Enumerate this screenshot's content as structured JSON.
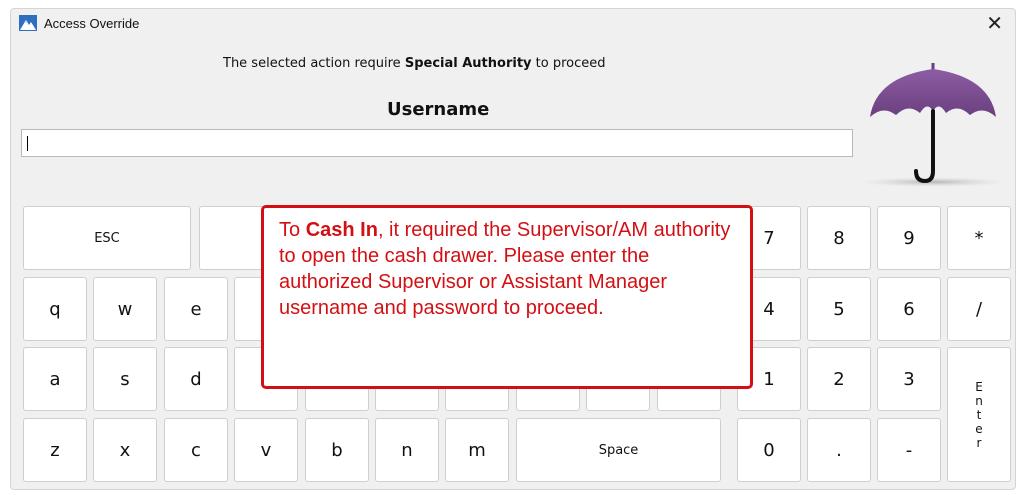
{
  "window": {
    "title": "Access Override",
    "close_glyph": "✕",
    "app_icon": "app-logo-icon"
  },
  "message": {
    "prefix": "The selected action require",
    "bold": "Special Authority",
    "suffix": "to proceed"
  },
  "username": {
    "label": "Username",
    "value": ""
  },
  "umbrella_icon": "umbrella-icon",
  "colors": {
    "window_bg": "#f0f0f0",
    "key_bg": "#ffffff",
    "callout_red": "#d40f14",
    "umbrella_purple": "#7a4d8d"
  },
  "keypad": {
    "esc": "ESC",
    "row_q": [
      "q",
      "w",
      "e"
    ],
    "row_a": [
      "a",
      "s",
      "d"
    ],
    "row_z": [
      "z",
      "x",
      "c",
      "v",
      "b",
      "n",
      "m"
    ],
    "space": "Space",
    "num_row1": [
      "7",
      "8",
      "9",
      "*"
    ],
    "num_row2": [
      "4",
      "5",
      "6",
      "/"
    ],
    "num_row3": [
      "1",
      "2",
      "3"
    ],
    "num_row4": [
      "0",
      ".",
      "-"
    ],
    "enter_letters": [
      "E",
      "n",
      "t",
      "e",
      "r"
    ]
  },
  "callout": {
    "lead": "To",
    "bold": "Cash In",
    "body": ", it required the Supervisor/AM authority to open the cash drawer. Please enter the authorized Supervisor or Assistant Manager username and password to proceed."
  }
}
